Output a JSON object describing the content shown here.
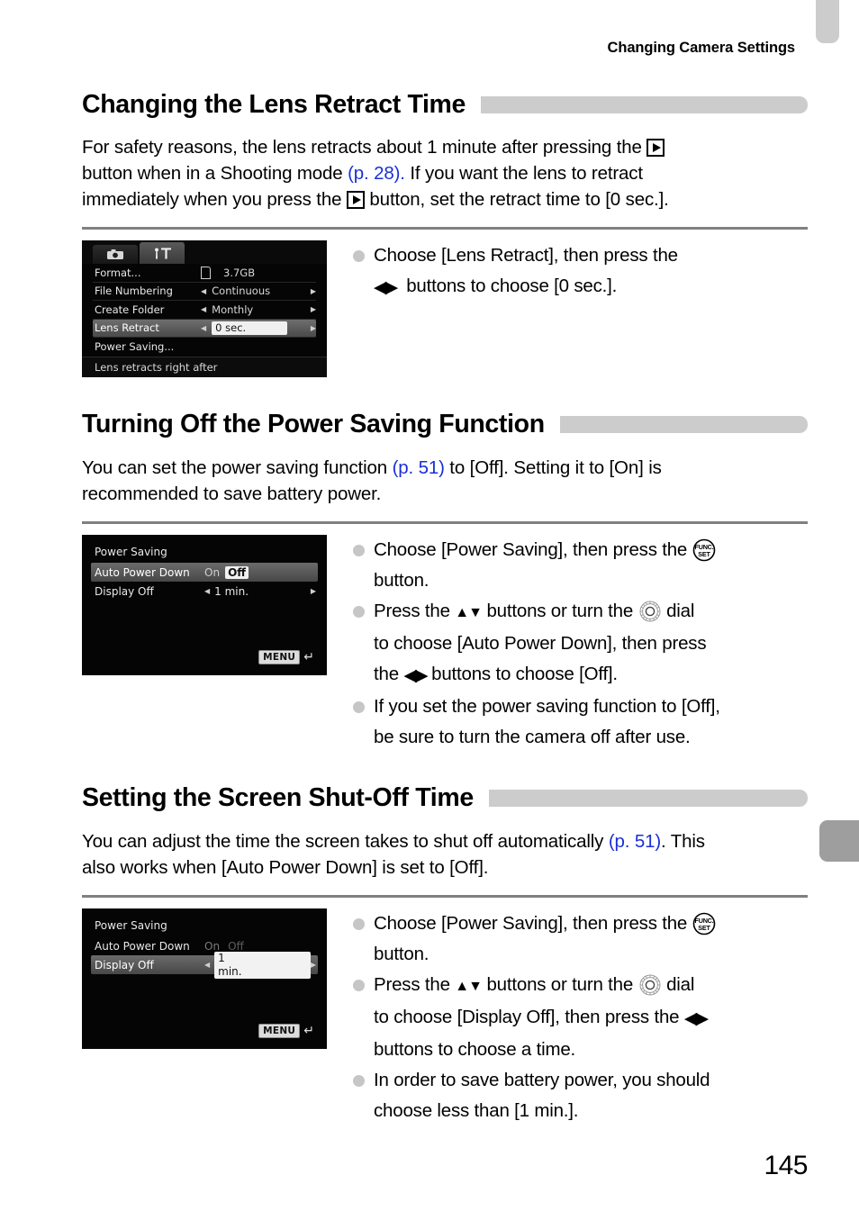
{
  "header": {
    "running_title": "Changing Camera Settings"
  },
  "page_number": "145",
  "sections": [
    {
      "heading": "Changing the Lens Retract Time",
      "body_line1_a": "For safety reasons, the lens retracts about 1 minute after pressing the ",
      "body_line1_b": "",
      "body_line2_a": "button when in a Shooting mode ",
      "body_ref1": "(p. 28).",
      "body_line2_b": " If you want the lens to retract",
      "body_line3_a": "immediately when you press the ",
      "body_line3_b": " button, set the retract time to [0 sec.].",
      "bullets": [
        {
          "line1_a": "Choose [Lens Retract], then press the",
          "line2_a": "buttons to choose [0 sec.]."
        }
      ]
    },
    {
      "heading": "Turning Off the Power Saving Function",
      "body_a": "You can set the power saving function ",
      "body_ref": "(p. 51)",
      "body_b": " to [Off]. Setting it to [On] is",
      "body_c": "recommended to save battery power."
    },
    {
      "heading": "Setting the Screen Shut-Off Time",
      "body_a": "You can adjust the time the screen takes to shut off automatically ",
      "body_ref": "(p. 51)",
      "body_b": ". This",
      "body_c": "also works when [Auto Power Down] is set to [Off]."
    }
  ],
  "bullets_group1": [
    {
      "seg1": "Choose [Lens Retract], then press the",
      "seg2": "buttons to choose [0 sec.]."
    }
  ],
  "bullets_group2": [
    {
      "seg1": "Choose [Power Saving], then press the",
      "seg2": "button."
    },
    {
      "seg1": "Press the",
      "seg2": "buttons or turn the",
      "seg3": "dial",
      "seg4": "to choose [Auto Power Down], then press",
      "seg5": "the",
      "seg6": "buttons to choose [Off]."
    },
    {
      "seg1": "If you set the power saving function to [Off],",
      "seg2": "be sure to turn the camera off after use."
    }
  ],
  "bullets_group3": [
    {
      "seg1": "Choose [Power Saving], then press the",
      "seg2": "button."
    },
    {
      "seg1": "Press the",
      "seg2": "buttons or turn the",
      "seg3": "dial",
      "seg4": "to choose [Display Off], then press the",
      "seg5": "buttons to choose a time."
    },
    {
      "seg1": "In order to save battery power, you should",
      "seg2": "choose less than [1 min.]."
    }
  ],
  "screen_menu": {
    "tabs": [
      {
        "icon": "camera-icon",
        "active": false
      },
      {
        "icon": "wrench-tools-icon",
        "active": true
      }
    ],
    "rows": [
      {
        "label": "Format...",
        "value": "3.7GB",
        "selected": false,
        "has_card_icon": true,
        "arrows": false
      },
      {
        "label": "File Numbering",
        "value": "Continuous",
        "selected": false,
        "arrows": true
      },
      {
        "label": "Create Folder",
        "value": "Monthly",
        "selected": false,
        "arrows": true
      },
      {
        "label": "Lens Retract",
        "value": "0 sec.",
        "selected": true,
        "arrows": true,
        "value_boxed": true
      },
      {
        "label": "Power Saving...",
        "value": "",
        "selected": false,
        "arrows": false
      }
    ],
    "footer_hint": "Lens retracts right after"
  },
  "screen_power_1": {
    "title": "Power Saving",
    "rows": [
      {
        "label": "Auto Power Down",
        "on_label": "On",
        "off_label": "Off",
        "selected": true,
        "off_highlighted": true
      },
      {
        "label": "Display Off",
        "value": "1 min.",
        "selected": false,
        "arrows": true
      }
    ],
    "menu_badge": "MENU",
    "return_glyph": "return-arrow-icon"
  },
  "screen_power_2": {
    "title": "Power Saving",
    "rows": [
      {
        "label": "Auto Power Down",
        "on_label": "On",
        "off_label": "Off",
        "selected": false,
        "dim": true
      },
      {
        "label": "Display Off",
        "value": "1 min.",
        "selected": true,
        "arrows": true,
        "value_boxed": true
      }
    ],
    "menu_badge": "MENU",
    "return_glyph": "return-arrow-icon"
  },
  "icons": {
    "playback": "playback-button-icon",
    "lr_arrows": "◀▶",
    "ud_arrows": "▲▼",
    "func_set_line1": "FUNC.",
    "func_set_line2": "SET",
    "dial": "control-dial-icon",
    "left_arrow": "◀",
    "right_arrow": "▶"
  },
  "colors": {
    "accent_link": "#1a2fd6",
    "heading_bar": "#cccccc",
    "rule": "#808080",
    "bullet_dot": "#c6c6c6",
    "tab_mid": "#9e9e9e"
  }
}
